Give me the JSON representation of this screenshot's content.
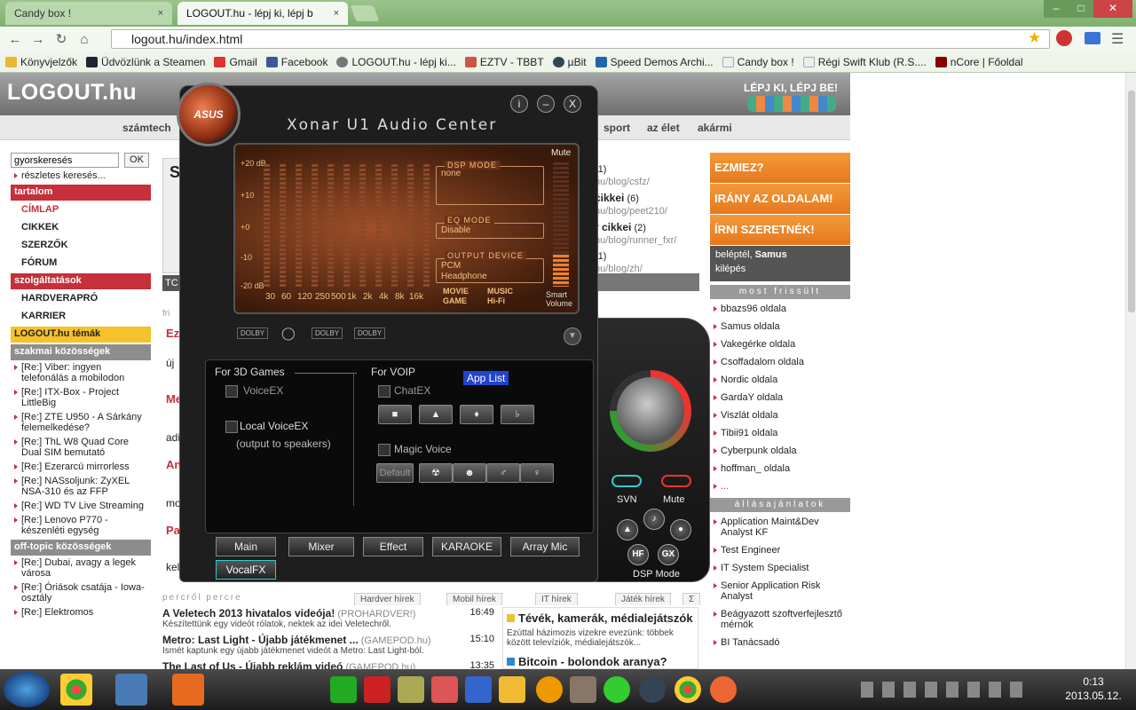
{
  "browser": {
    "tabs": [
      {
        "label": "Candy box !",
        "close": "×"
      },
      {
        "label": "LOGOUT.hu - lépj ki, lépj b",
        "close": "×"
      }
    ],
    "url": "logout.hu/index.html",
    "bookmarks": [
      "Könyvjelzők",
      "Üdvözlünk a Steamen",
      "Gmail",
      "Facebook",
      "LOGOUT.hu - lépj ki...",
      "EZTV - TBBT",
      "µBit",
      "Speed Demos Archi...",
      "Candy box !",
      "Régi Swift Klub (R.S....",
      "nCore | Főoldal"
    ]
  },
  "site": {
    "logo": "LOGOUT.hu",
    "slogan": "LÉPJ KI, LÉPJ BE!",
    "nav": [
      "számtech",
      "sport",
      "az élet",
      "akármi"
    ],
    "search": {
      "value": "gyorskeresés",
      "ok": "OK",
      "advanced": "részletes keresés..."
    },
    "left": {
      "tartalom": "tartalom",
      "main_items": [
        "CÍMLAP",
        "CIKKEK",
        "SZERZŐK",
        "FÓRUM"
      ],
      "szolgaltatasok": "szolgáltatások",
      "service_items": [
        "HARDVERAPRÓ",
        "KARRIER"
      ],
      "temak": "LOGOUT.hu témák",
      "szakmai": "szakmai közösségek",
      "szakmai_items": [
        "[Re:] Viber: ingyen telefonálás a mobilodon",
        "[Re:] ITX-Box - Project LittleBig",
        "[Re:] ZTE U950 - A Sárkány felemelkedése?",
        "[Re:] ThL W8 Quad Core Dual SIM bemutató",
        "[Re:] Ezerarcú mirrorless",
        "[Re:] NASsoljunk: ZyXEL NSA-310 és az FFP",
        "[Re:] WD TV Live Streaming",
        "[Re:] Lenovo P770 - készenléti egység"
      ],
      "offtopic": "off-topic közösségek",
      "offtopic_items": [
        "[Re:] Dubai, avagy a legek városa",
        "[Re:] Óriások csatája - Iowa-osztály",
        "[Re:] Elektromos"
      ]
    },
    "right": {
      "ezmiez": "EZMIEZ?",
      "irany": "IRÁNY AZ OLDALAM!",
      "irni": "ÍRNI SZERETNÉK!",
      "beleptel": "beléptél,",
      "user": "Samus",
      "kilepes": "kilépés",
      "most_frissult": "most frissült",
      "updated": [
        "bbazs96 oldala",
        "Samus oldala",
        "Vakegérke oldala",
        "Csoffadalom oldala",
        "Nordic oldala",
        "GardaY oldala",
        "Viszlát oldala",
        "Tibii91 oldala",
        "Cyberpunk oldala",
        "hoffman_ oldala",
        "..."
      ],
      "allas": "állásajánlatok",
      "jobs": [
        "Application Maint&Dev Analyst KF",
        "Test Engineer",
        "IT System Specialist",
        "Senior Application Risk Analyst",
        "Beágyazott szoftverfejlesztő mérnök",
        "BI Tanácsadó"
      ]
    },
    "blog": [
      {
        "name": "(1)",
        "url": "hu/blog/csfz/"
      },
      {
        "name": "cikkei",
        "count": "(6)",
        "url": "hu/blog/peet210/"
      },
      {
        "name": "r cikkei",
        "count": "(2)",
        "url": "hu/blog/runner_fxr/"
      },
      {
        "name": "(1)",
        "url": "hu/blog/zh/"
      }
    ],
    "center_fragments": {
      "ez": "Ez",
      "uj": "új",
      "me": "Me",
      "ad": "adi",
      "an": "An",
      "mo": "mo",
      "pa": "Pa",
      "ke": "kel",
      "to": "TC",
      "s": "S",
      "fri": "fri"
    },
    "news_header": "percről percre",
    "news_tabs": [
      "Hardver hírek",
      "Mobil hírek",
      "IT hírek",
      "Játék hírek",
      "Σ"
    ],
    "news": [
      {
        "title": "A Veletech 2013 hivatalos videója!",
        "source": "(PROHARDVER!)",
        "time": "16:49",
        "desc": "Készítettünk egy videót rólatok, nektek az idei Veletechről."
      },
      {
        "title": "Metro: Last Light - Újabb játékmenet ...",
        "source": "(GAMEPOD.hu)",
        "time": "15:10",
        "desc": "Ismét kaptunk egy újabb játékmenet videót a Metro: Last Light-ból."
      },
      {
        "title": "The Last of Us - Újabb reklám videó",
        "source": "(GAMEPOD.hu)",
        "time": "13:35",
        "desc": ""
      }
    ],
    "side_articles": [
      {
        "title": "Tévék, kamerák, médialejátszók",
        "desc": "Ezúttal házimozis vizekre evezünk: többek között televíziók, médialejátszók..."
      },
      {
        "title": "Bitcoin - bolondok aranya?",
        "desc": ""
      }
    ]
  },
  "xonar": {
    "title": "Xonar U1 Audio Center",
    "brand": "ASUS",
    "buttons": [
      "i",
      "–",
      "X"
    ],
    "y_labels": [
      "+20 dB",
      "+10",
      "+0",
      "-10",
      "-20 dB"
    ],
    "freqs": [
      "30",
      "60",
      "120",
      "250",
      "500",
      "1k",
      "2k",
      "4k",
      "8k",
      "16k"
    ],
    "dsp_mode_label": "DSP MODE",
    "dsp_mode_value": "none",
    "eq_mode_label": "EQ MODE",
    "eq_mode_value": "Disable",
    "output_label": "OUTPUT DEVICE",
    "output_values": [
      "PCM",
      "Headphone"
    ],
    "movie": "MOVIE",
    "game": "GAME",
    "music": "MUSIC",
    "hifi": "Hi-Fi",
    "mute": "Mute",
    "smart_volume": "Smart Volume",
    "dolby": [
      "DOLBY",
      "DOLBY",
      "DOLBY"
    ],
    "for_3d": "For 3D Games",
    "voiceex": "VoiceEX",
    "local_voiceex": "Local VoiceEX",
    "output_speakers": "(output to speakers)",
    "for_voip": "For VOIP",
    "app_list": "App List",
    "chatex": "ChatEX",
    "magic_voice": "Magic Voice",
    "default": "Default",
    "tabs": [
      "Main",
      "Mixer",
      "Effect",
      "KARAOKE",
      "Array Mic",
      "VocalFX"
    ],
    "svn": "SVN",
    "mute_btn": "Mute",
    "hf": "HF",
    "gx": "GX",
    "dsp_mode": "DSP Mode"
  },
  "taskbar": {
    "time": "0:13",
    "date": "2013.05.12."
  }
}
